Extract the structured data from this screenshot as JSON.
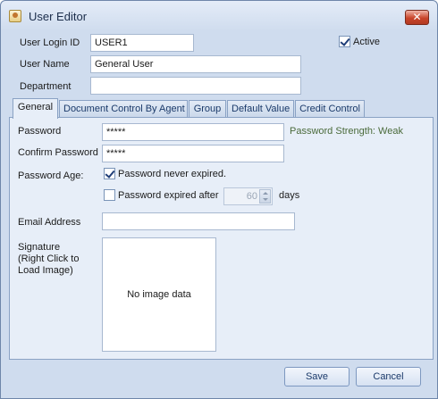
{
  "window": {
    "title": "User Editor",
    "close_glyph": "✕"
  },
  "header": {
    "login_id_label": "User Login ID",
    "login_id_value": "USER1",
    "active_label": "Active",
    "active_checked": true,
    "user_name_label": "User Name",
    "user_name_value": "General User",
    "department_label": "Department",
    "department_value": ""
  },
  "tabs": [
    {
      "label": "General",
      "active": true
    },
    {
      "label": "Document Control By Agent",
      "active": false
    },
    {
      "label": "Group",
      "active": false
    },
    {
      "label": "Default Value",
      "active": false
    },
    {
      "label": "Credit Control",
      "active": false
    }
  ],
  "general": {
    "password_label": "Password",
    "password_value": "*****",
    "password_strength": "Password Strength: Weak",
    "confirm_password_label": "Confirm Password",
    "confirm_password_value": "*****",
    "password_age_label": "Password Age:",
    "never_expired_label": "Password never expired.",
    "never_expired_checked": true,
    "expired_after_label": "Password expired after",
    "expired_after_checked": false,
    "expired_days_value": "60",
    "days_label": "days",
    "email_label": "Email Address",
    "email_value": "",
    "signature_label_line1": "Signature",
    "signature_label_line2": "(Right Click to",
    "signature_label_line3": "Load Image)",
    "no_image_text": "No image data"
  },
  "footer": {
    "save_label": "Save",
    "cancel_label": "Cancel"
  },
  "colors": {
    "strength_text": "#4a6a3a",
    "window_bg": "#cfdcee"
  }
}
